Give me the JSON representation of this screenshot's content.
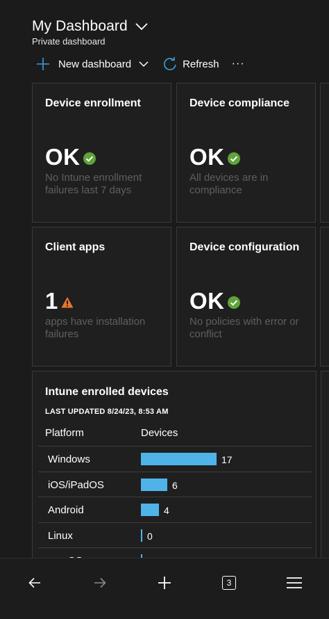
{
  "header": {
    "title": "My Dashboard",
    "subtitle": "Private dashboard"
  },
  "toolbar": {
    "new_dashboard_label": "New dashboard",
    "refresh_label": "Refresh",
    "more_label": "···"
  },
  "tiles": [
    {
      "title": "Device enrollment",
      "value": "OK",
      "status": "ok",
      "description": "No Intune enrollment failures last 7 days"
    },
    {
      "title": "Device compliance",
      "value": "OK",
      "status": "ok",
      "description": "All devices are in compliance"
    },
    {
      "title": "Client apps",
      "value": "1",
      "status": "warning",
      "description": "apps have installation failures"
    },
    {
      "title": "Device configuration",
      "value": "OK",
      "status": "ok",
      "description": "No policies with error or conflict"
    }
  ],
  "enrolled_devices": {
    "title": "Intune enrolled devices",
    "last_updated": "LAST UPDATED 8/24/23, 8:53 AM",
    "columns": [
      "Platform",
      "Devices"
    ],
    "rows": [
      {
        "platform": "Windows",
        "devices": "17",
        "count": 17
      },
      {
        "platform": "iOS/iPadOS",
        "devices": "6",
        "count": 6
      },
      {
        "platform": "Android",
        "devices": "4",
        "count": 4
      },
      {
        "platform": "Linux",
        "devices": "0",
        "count": 0
      },
      {
        "platform": "macOS",
        "devices": "0",
        "count": 0
      }
    ],
    "max_count": 17
  },
  "bottom_nav": {
    "tab_count": "3"
  },
  "colors": {
    "background": "#1b1b1b",
    "tile_background": "#1f1f1f",
    "ok_green": "#5ea33b",
    "warning_orange": "#e8762c",
    "bar_blue": "#4fb3e9",
    "refresh_blue": "#3b9de0"
  },
  "icons": {
    "title_chevron": "chevron-down-icon",
    "new": "plus-icon",
    "refresh": "refresh-icon",
    "ok": "check-circle-icon",
    "warning": "warning-triangle-icon",
    "back": "arrow-left-icon",
    "forward": "arrow-right-icon",
    "add": "plus-icon",
    "tabs": "tabs-icon",
    "menu": "hamburger-menu-icon"
  }
}
